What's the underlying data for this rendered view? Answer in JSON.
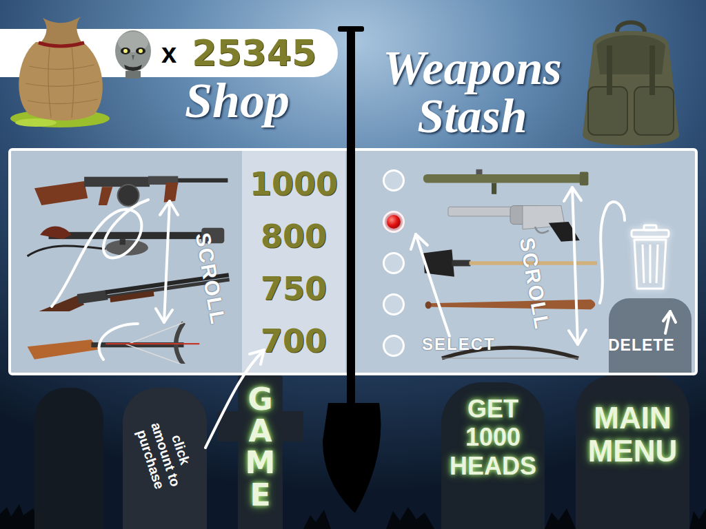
{
  "counter": {
    "multiplier": "x",
    "count": "25345"
  },
  "shop": {
    "title": "Shop",
    "items": [
      {
        "kind": "tommygun",
        "price": "1000"
      },
      {
        "kind": "flamethrower",
        "price": "800"
      },
      {
        "kind": "shotgun",
        "price": "750"
      },
      {
        "kind": "crossbow",
        "price": "700"
      }
    ]
  },
  "stash": {
    "title": "Weapons Stash",
    "items": [
      {
        "kind": "bazooka",
        "selected": false
      },
      {
        "kind": "revolver",
        "selected": true
      },
      {
        "kind": "shovel",
        "selected": false
      },
      {
        "kind": "bat",
        "selected": false
      },
      {
        "kind": "bow",
        "selected": false
      }
    ]
  },
  "hints": {
    "shop_scroll": "SCROLL",
    "stash_scroll": "SCROLL",
    "select": "SELECT",
    "delete": "DELETE",
    "purchase": "click amount to purchase"
  },
  "buttons": [
    {
      "label": "GAME",
      "kind": "cross"
    },
    {
      "label": "GET 1000 HEADS",
      "kind": "tombstone"
    },
    {
      "label": "MAIN MENU",
      "kind": "tombstone"
    }
  ]
}
